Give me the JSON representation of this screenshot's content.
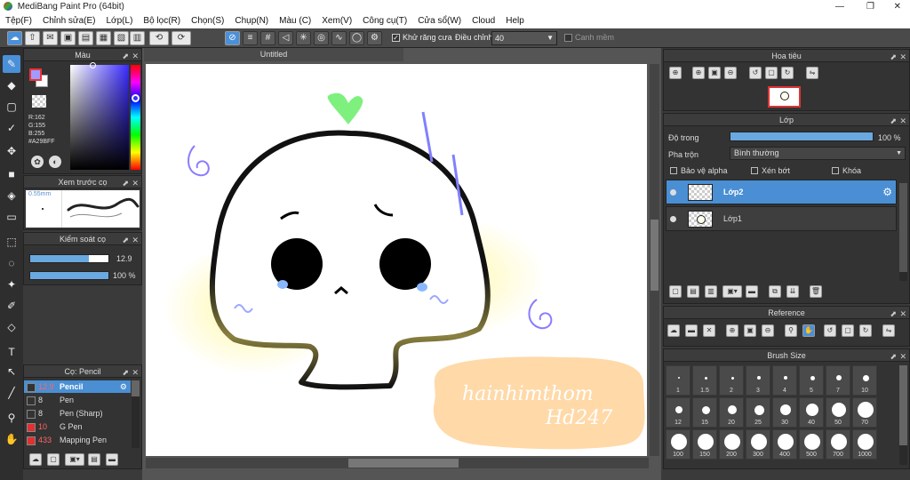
{
  "window": {
    "title": "MediBang Paint Pro (64bit)",
    "controls": [
      "—",
      "❐",
      "✕"
    ]
  },
  "menu": [
    "Tệp(F)",
    "Chỉnh sửa(E)",
    "Lớp(L)",
    "Bộ lọc(R)",
    "Chọn(S)",
    "Chụp(N)",
    "Màu (C)",
    "Xem(V)",
    "Công cụ(T)",
    "Cửa sổ(W)",
    "Cloud",
    "Help"
  ],
  "toolbar": {
    "antialias_label": "Khử răng cưa",
    "adjust_label": "Điều chỉnh",
    "adjust_value": "40",
    "snap_label": "Canh mềm"
  },
  "color_panel": {
    "title": "Màu",
    "r": "R:162",
    "g": "G:155",
    "b": "B:255",
    "hex": "#A29BFF",
    "fg": "#A29BFF"
  },
  "brush_preview": {
    "title": "Xem trước cọ",
    "size": "0.55mm"
  },
  "brush_control": {
    "title": "Kiểm soát cọ",
    "size_value": "12.9",
    "opacity_value": "100 %",
    "size_fraction": 0.75,
    "opacity_fraction": 1.0
  },
  "brush_list": {
    "title": "Cọ: Pencil",
    "items": [
      {
        "size": "12.9",
        "name": "Pencil",
        "color": "#333333",
        "selected": true
      },
      {
        "size": "8",
        "name": "Pen",
        "color": "#333333",
        "selected": false
      },
      {
        "size": "8",
        "name": "Pen (Sharp)",
        "color": "#333333",
        "selected": false
      },
      {
        "size": "10",
        "name": "G Pen",
        "color": "#e03030",
        "selected": false
      },
      {
        "size": "433",
        "name": "Mapping Pen",
        "color": "#e03030",
        "selected": false
      }
    ]
  },
  "canvas": {
    "tab_title": "Untitled",
    "signature": "hainhimthom",
    "signature2": "Hd247"
  },
  "navigator": {
    "title": "Hoa tiêu"
  },
  "layers": {
    "title": "Lớp",
    "opacity_label": "Độ trong",
    "opacity_value": "100 %",
    "opacity_fraction": 1.0,
    "blend_label": "Pha trộn",
    "blend_value": "Bình thường",
    "protect_alpha": "Bảo vệ alpha",
    "clipping": "Xén bớt",
    "lock": "Khóa",
    "items": [
      {
        "name": "Lớp2",
        "selected": true
      },
      {
        "name": "Lớp1",
        "selected": false
      }
    ]
  },
  "reference": {
    "title": "Reference"
  },
  "brush_size": {
    "title": "Brush Size",
    "sizes": [
      "1",
      "1.5",
      "2",
      "3",
      "4",
      "5",
      "7",
      "10",
      "12",
      "15",
      "20",
      "25",
      "30",
      "40",
      "50",
      "70",
      "100",
      "150",
      "200",
      "300",
      "400",
      "500",
      "700",
      "1000"
    ]
  }
}
